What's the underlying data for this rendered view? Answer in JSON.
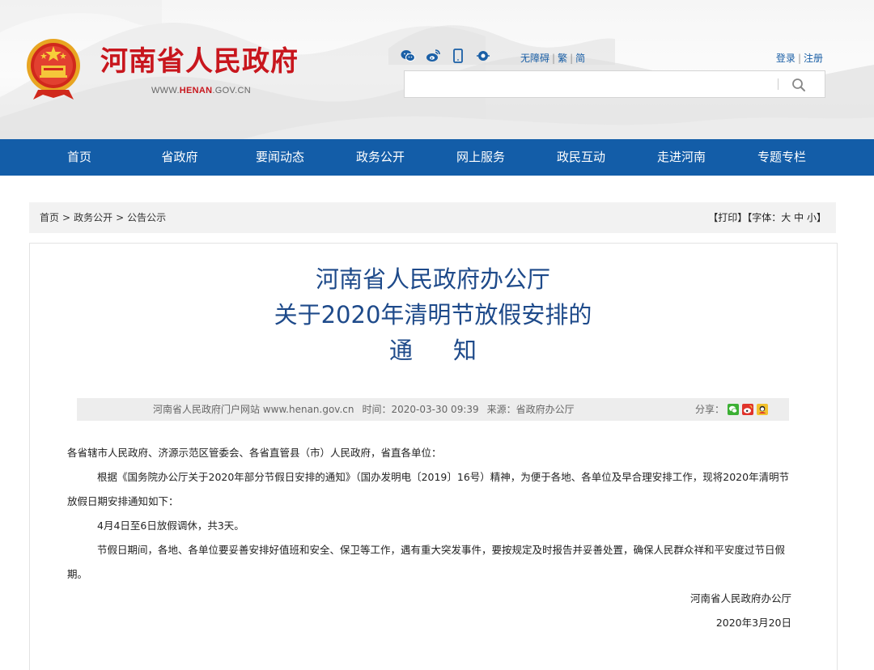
{
  "header": {
    "site_name": "河南省人民政府",
    "domain_prefix": "WWW.",
    "domain_brand": "HENAN",
    "domain_suffix": ".GOV.CN",
    "social_icons": [
      "wechat-icon",
      "weibo-icon",
      "mobile-icon",
      "app-icon"
    ],
    "access_links": {
      "barrier_free": "无障碍",
      "traditional": "繁",
      "simplified": "简"
    },
    "login_links": {
      "login": "登录",
      "register": "注册"
    },
    "search": {
      "placeholder": ""
    }
  },
  "nav": {
    "items": [
      "首页",
      "省政府",
      "要闻动态",
      "政务公开",
      "网上服务",
      "政民互动",
      "走进河南",
      "专题专栏"
    ]
  },
  "breadcrumb": {
    "items": [
      "首页",
      "政务公开",
      "公告公示"
    ],
    "separator": ">"
  },
  "page_tools": {
    "print": "【打印】",
    "font_label": "【字体：",
    "large": "大",
    "medium": "中",
    "small": "小",
    "font_end": "】"
  },
  "article": {
    "title_line1": "河南省人民政府办公厅",
    "title_line2": "关于2020年清明节放假安排的",
    "title_line3": "通知",
    "meta": {
      "source_site": "河南省人民政府门户网站 www.henan.gov.cn",
      "time": "时间：2020-03-30 09:39",
      "origin": "来源：省政府办公厅",
      "share_label": "分享："
    },
    "share_icons": [
      "wechat-share-icon",
      "weibo-share-icon",
      "qzone-share-icon"
    ],
    "paragraphs": [
      "各省辖市人民政府、济源示范区管委会、各省直管县（市）人民政府，省直各单位：",
      "根据《国务院办公厅关于2020年部分节假日安排的通知》（国办发明电〔2019〕16号）精神，为便于各地、各单位及早合理安排工作，现将2020年清明节放假日期安排通知如下：",
      "4月4日至6日放假调休，共3天。",
      "节假日期间，各地、各单位要妥善安排好值班和安全、保卫等工作，遇有重大突发事件，要按规定及时报告并妥善处置，确保人民群众祥和平安度过节日假期。"
    ],
    "signature": "河南省人民政府办公厅",
    "date": "2020年3月20日"
  },
  "colors": {
    "brand_red": "#c8161d",
    "nav_blue": "#135da8",
    "title_blue": "#1e4a8a",
    "link_blue": "#1a5fa6"
  }
}
